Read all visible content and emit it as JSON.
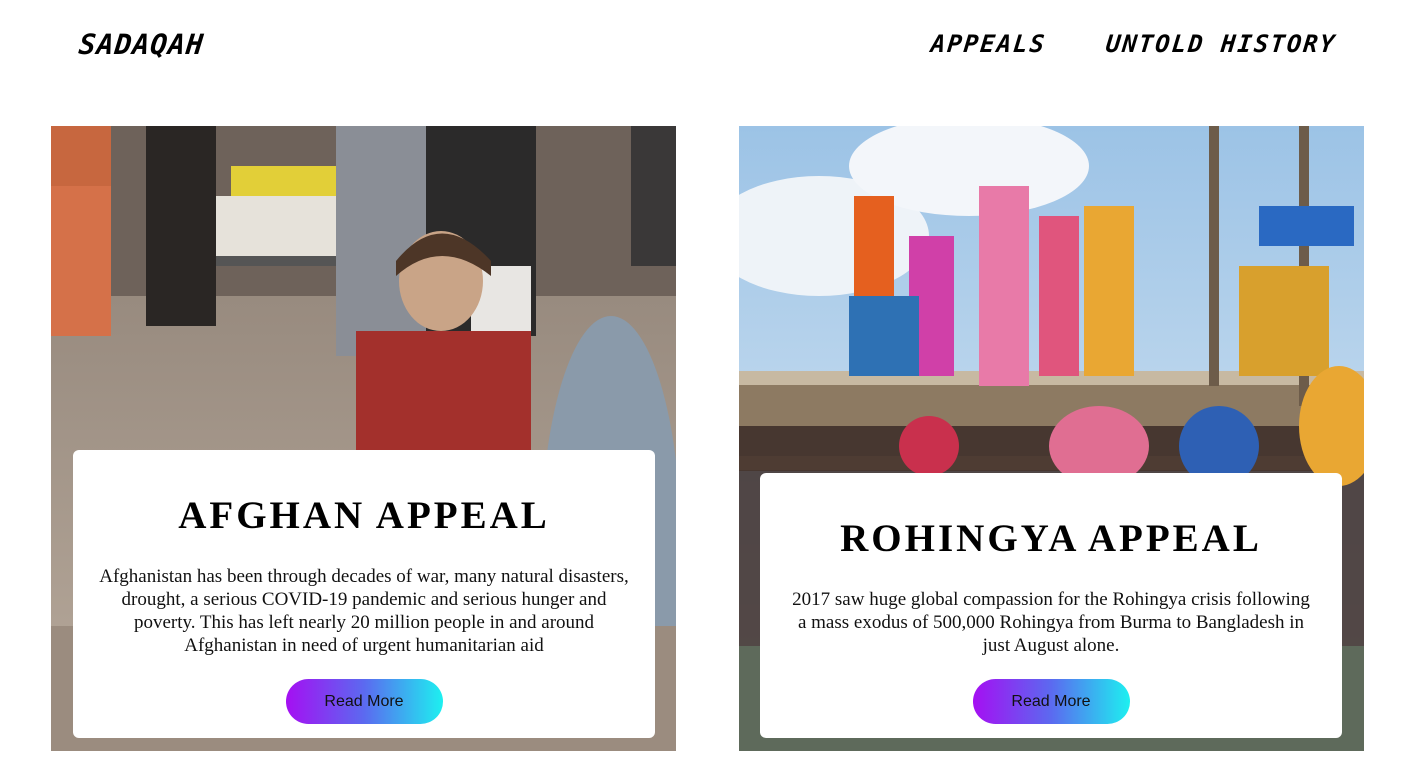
{
  "header": {
    "logo": "SADAQAH",
    "nav": [
      {
        "label": "APPEALS"
      },
      {
        "label": "UNTOLD HISTORY"
      }
    ]
  },
  "appeals": [
    {
      "title": "AFGHAN APPEAL",
      "description": "Afghanistan has been through decades of war, many natural disasters, drought, a serious COVID-19 pandemic and serious hunger and poverty. This has left nearly 20 million people in and around Afghanistan in need of urgent humanitarian aid",
      "button_label": "Read More"
    },
    {
      "title": "ROHINGYA APPEAL",
      "description": "2017 saw huge global compassion for the Rohingya crisis following a mass exodus of 500,000 Rohingya from Burma to Bangladesh in just August alone.",
      "button_label": "Read More"
    }
  ],
  "colors": {
    "button_gradient_start": "#a50ff2",
    "button_gradient_end": "#1df0f0"
  }
}
